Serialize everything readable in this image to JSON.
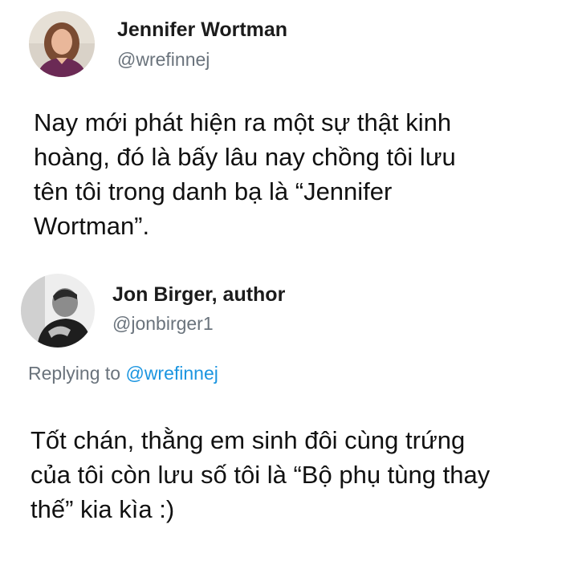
{
  "original_tweet": {
    "author_name": "Jennifer Wortman",
    "author_handle": "@wrefinnej",
    "avatar_icon": "profile-photo-woman",
    "text_lines": [
      "Nay mới phát hiện ra một sự thật kinh",
      "hoàng, đó là bấy lâu nay chồng tôi lưu",
      "tên tôi trong danh bạ là “Jennifer",
      "Wortman”."
    ]
  },
  "reply_tweet": {
    "author_name": "Jon Birger, author",
    "author_handle": "@jonbirger1",
    "avatar_icon": "profile-photo-man",
    "replying_label": "Replying to",
    "replying_to": "@wrefinnej",
    "text_lines": [
      "Tốt chán, thằng em sinh đôi cùng trứng",
      "của tôi còn lưu số tôi là “Bộ phụ tùng thay",
      "thế” kia kìa :)"
    ]
  },
  "colors": {
    "text": "#111111",
    "secondary": "#6a737c",
    "mention": "#1b95e0"
  }
}
